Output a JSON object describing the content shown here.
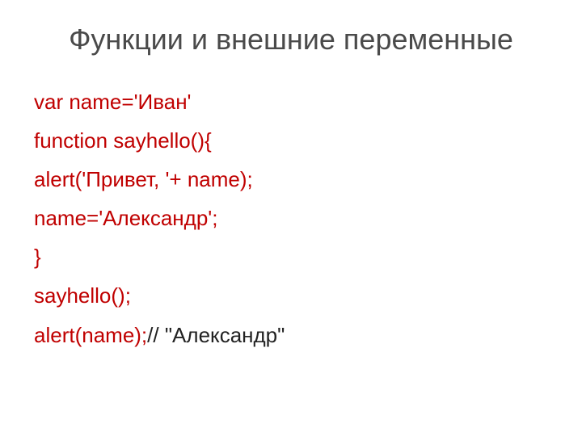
{
  "slide": {
    "title": "Функции и внешние переменные",
    "lines": [
      {
        "red": "var name='Иван'",
        "black": ""
      },
      {
        "red": "function sayhello(){",
        "black": ""
      },
      {
        "red": "alert('Привет, '+ name);",
        "black": ""
      },
      {
        "red": "name='Александр';",
        "black": ""
      },
      {
        "red": "}",
        "black": ""
      },
      {
        "red": "sayhello();",
        "black": ""
      },
      {
        "red": "alert(name);",
        "black": "// \"Александр\""
      }
    ]
  }
}
